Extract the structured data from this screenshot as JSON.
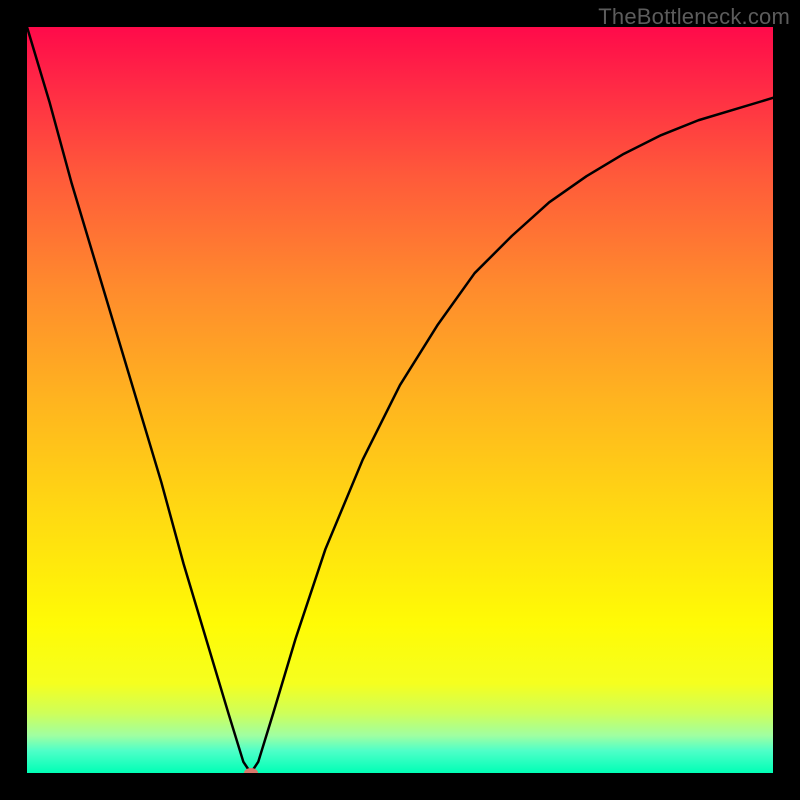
{
  "watermark": "TheBottleneck.com",
  "chart_data": {
    "type": "line",
    "title": "",
    "xlabel": "",
    "ylabel": "",
    "xlim": [
      0,
      100
    ],
    "ylim": [
      0,
      100
    ],
    "grid": false,
    "legend": false,
    "background_gradient": [
      "#ff0a4a",
      "#ff5a3a",
      "#ffb41f",
      "#fffb05",
      "#00ffb6"
    ],
    "series": [
      {
        "name": "bottleneck-curve",
        "color": "#000000",
        "x": [
          0,
          3,
          6,
          9,
          12,
          15,
          18,
          21,
          24,
          27,
          29,
          30,
          31,
          33,
          36,
          40,
          45,
          50,
          55,
          60,
          65,
          70,
          75,
          80,
          85,
          90,
          95,
          100
        ],
        "y": [
          100,
          90,
          79,
          69,
          59,
          49,
          39,
          28,
          18,
          8,
          1.5,
          0,
          1.5,
          8,
          18,
          30,
          42,
          52,
          60,
          67,
          72,
          76.5,
          80,
          83,
          85.5,
          87.5,
          89,
          90.5
        ]
      }
    ],
    "marker": {
      "x": 30,
      "y": 0,
      "color": "#d9786c"
    }
  }
}
